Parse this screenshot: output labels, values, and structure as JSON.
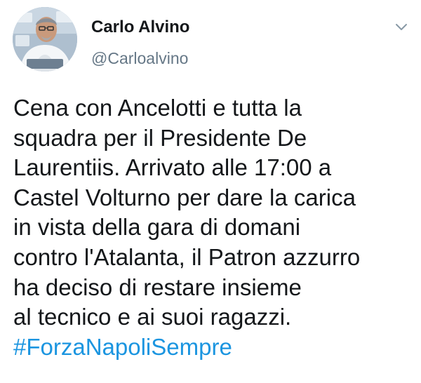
{
  "author": {
    "name": "Carlo Alvino",
    "handle": "@Carloalvino",
    "avatar_icon": "profile-photo"
  },
  "menu_icon": "chevron-down-icon",
  "tweet": {
    "lines": [
      "Cena con Ancelotti e tutta la",
      "squadra per il Presidente De",
      "Laurentiis. Arrivato alle 17:00 a",
      "Castel Volturno per dare la carica",
      "in vista della gara di domani",
      "contro l'Atalanta, il Patron azzurro",
      "ha deciso di restare insieme",
      "al tecnico e ai suoi ragazzi."
    ],
    "hashtag": "#ForzaNapoliSempre"
  },
  "colors": {
    "hashtag": "#1b95e0",
    "handle": "#657786",
    "text": "#14171a"
  }
}
